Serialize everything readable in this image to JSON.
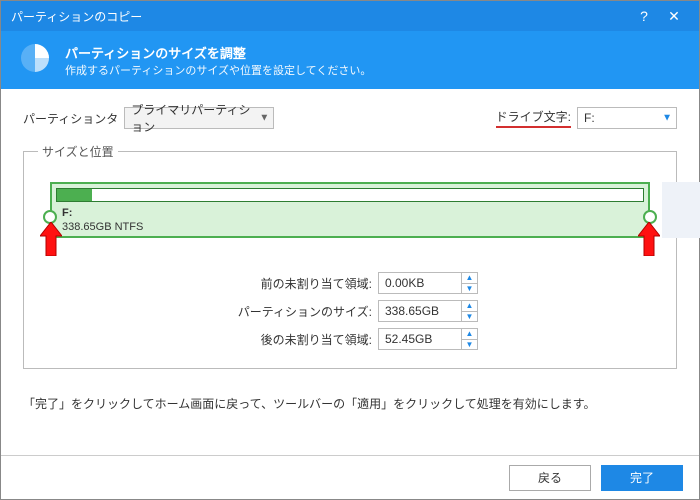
{
  "window": {
    "title": "パーティションのコピー"
  },
  "header": {
    "title": "パーティションのサイズを調整",
    "subtitle": "作成するパーティションのサイズや位置を設定してください。"
  },
  "labels": {
    "partition_type": "パーティションタ",
    "drive_letter": "ドライブ文字:",
    "fieldset": "サイズと位置",
    "unalloc_before": "前の未割り当て領域:",
    "partition_size": "パーティションのサイズ:",
    "unalloc_after": "後の未割り当て領域:"
  },
  "values": {
    "partition_type": "プライマリパーティション",
    "drive_letter": "F:",
    "bar_drive": "F:",
    "bar_info": "338.65GB NTFS",
    "unalloc_before": "0.00KB",
    "partition_size": "338.65GB",
    "unalloc_after": "52.45GB"
  },
  "hint": "「完了」をクリックしてホーム画面に戻って、ツールバーの「適用」をクリックして処理を有効にします。",
  "buttons": {
    "back": "戻る",
    "finish": "完了"
  }
}
